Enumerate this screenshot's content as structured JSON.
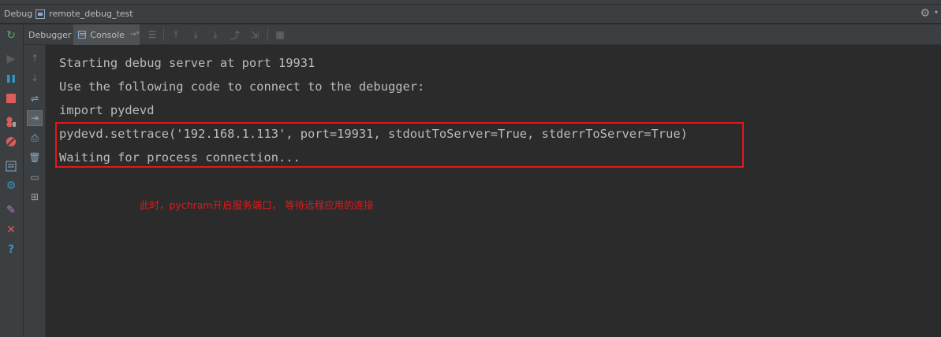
{
  "window": {
    "tool_label": "Debug",
    "config_name": "remote_debug_test"
  },
  "tabs": {
    "debugger_label": "Debugger",
    "console_label": "Console",
    "console_pin": "→*"
  },
  "console": {
    "lines": [
      "Starting debug server at port 19931",
      "Use the following code to connect to the debugger:",
      "import pydevd",
      "pydevd.settrace('192.168.1.113', port=19931, stdoutToServer=True, stderrToServer=True)",
      "Waiting for process connection..."
    ]
  },
  "annotation": {
    "text": "此时，pychram开启服务端口， 等待远程应用的连接"
  },
  "icons": {
    "left": [
      "rerun-icon",
      "resume-icon",
      "pause-icon",
      "stop-icon",
      "view-breakpoints-icon",
      "mute-breakpoints-icon",
      "restore-layout-icon",
      "settings-icon",
      "pin-icon",
      "close-icon",
      "help-icon"
    ],
    "sub": [
      "up-icon",
      "down-icon",
      "soft-wrap-icon",
      "scroll-to-end-icon",
      "print-icon",
      "clear-all-icon",
      "show-python-prompt-icon",
      "attach-debugger-icon"
    ]
  },
  "colors": {
    "background": "#2b2b2b",
    "panel": "#3c3f41",
    "text": "#bbbbbb",
    "highlight": "#e1191b"
  }
}
